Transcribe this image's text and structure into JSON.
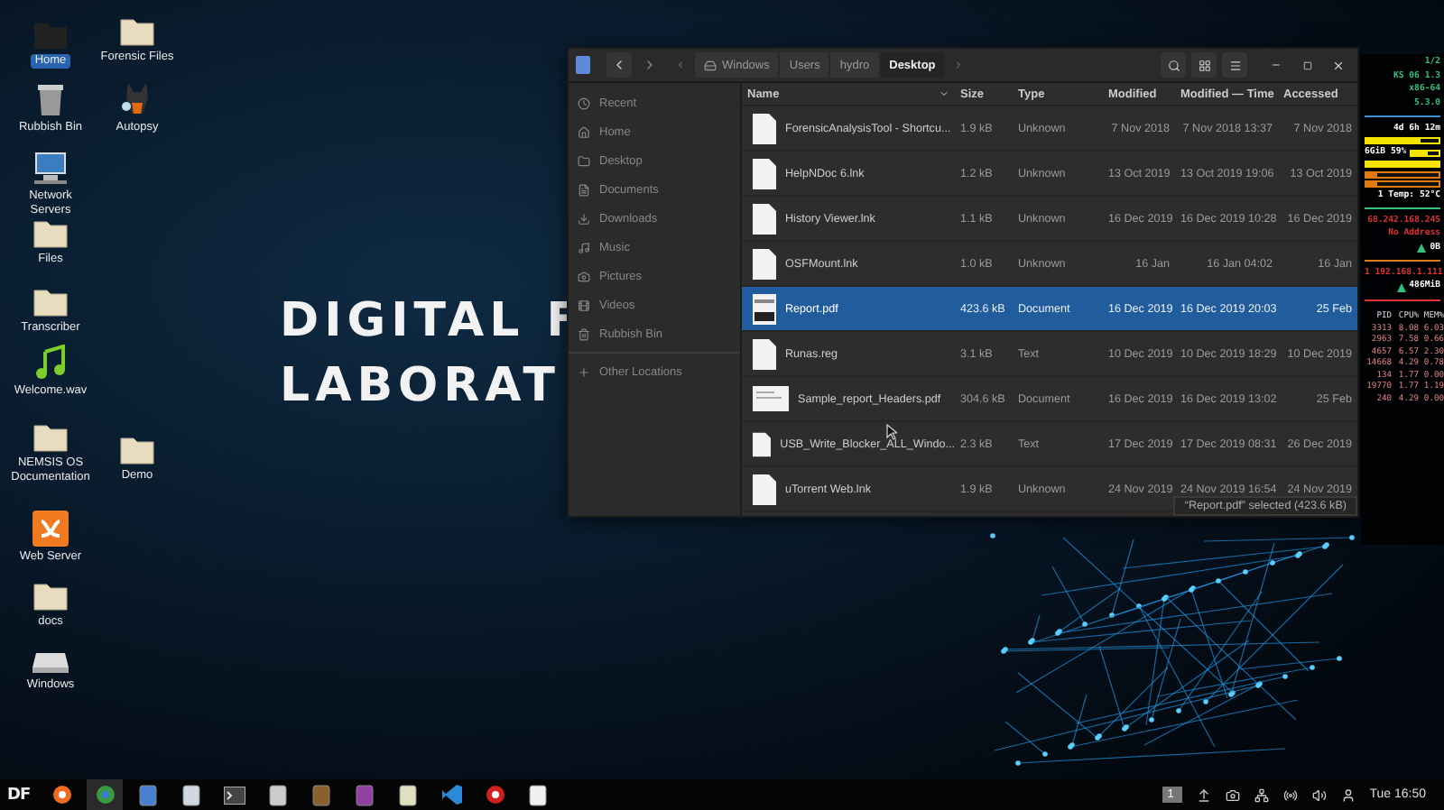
{
  "desktop": {
    "banner": [
      "DIGITAL F",
      "LABORAT"
    ],
    "icons": [
      {
        "label": "Home",
        "kind": "home",
        "selected": true
      },
      {
        "label": "Rubbish Bin",
        "kind": "trash",
        "selected": false
      },
      {
        "label": "Network Servers",
        "kind": "network",
        "selected": false
      },
      {
        "label": "Files",
        "kind": "folder",
        "selected": false
      },
      {
        "label": "Transcriber",
        "kind": "folder",
        "selected": false
      },
      {
        "label": "Welcome.wav",
        "kind": "music",
        "selected": false
      },
      {
        "label": "NEMSIS OS Documentation",
        "kind": "folder",
        "selected": false
      },
      {
        "label": "Web Server",
        "kind": "server",
        "selected": false
      },
      {
        "label": "docs",
        "kind": "folder",
        "selected": false
      },
      {
        "label": "Windows",
        "kind": "drive",
        "selected": false
      },
      {
        "label": "Forensic Files",
        "kind": "folder",
        "selected": false
      },
      {
        "label": "Autopsy",
        "kind": "dog",
        "selected": false
      },
      {
        "label": "Demo",
        "kind": "folder",
        "selected": false
      }
    ]
  },
  "file_manager": {
    "path": [
      {
        "label": "Windows",
        "selected": false
      },
      {
        "label": "Users",
        "selected": false
      },
      {
        "label": "hydro",
        "selected": false
      },
      {
        "label": "Desktop",
        "selected": true
      }
    ],
    "sidebar": [
      {
        "label": "Recent",
        "kind": "clock"
      },
      {
        "label": "Home",
        "kind": "home"
      },
      {
        "label": "Desktop",
        "kind": "folder"
      },
      {
        "label": "Documents",
        "kind": "doc"
      },
      {
        "label": "Downloads",
        "kind": "download"
      },
      {
        "label": "Music",
        "kind": "music"
      },
      {
        "label": "Pictures",
        "kind": "camera"
      },
      {
        "label": "Videos",
        "kind": "video"
      },
      {
        "label": "Rubbish Bin",
        "kind": "trash"
      },
      {
        "label": "Other Locations",
        "kind": "plus"
      }
    ],
    "columns": [
      "Name",
      "Size",
      "Type",
      "Modified",
      "Modified — Time",
      "Accessed"
    ],
    "rows": [
      {
        "name": "ForensicAnalysisTool - Shortcu...",
        "size": "1.9 kB",
        "type": "Unknown",
        "modified": "7 Nov 2018",
        "modified_time": "7 Nov 2018 13:37",
        "accessed": "7 Nov 2018",
        "kind": "doc",
        "selected": false
      },
      {
        "name": "HelpNDoc 6.lnk",
        "size": "1.2 kB",
        "type": "Unknown",
        "modified": "13 Oct 2019",
        "modified_time": "13 Oct 2019 19:06",
        "accessed": "13 Oct 2019",
        "kind": "doc",
        "selected": false
      },
      {
        "name": "History Viewer.lnk",
        "size": "1.1 kB",
        "type": "Unknown",
        "modified": "16 Dec 2019",
        "modified_time": "16 Dec 2019 10:28",
        "accessed": "16 Dec 2019",
        "kind": "doc",
        "selected": false
      },
      {
        "name": "OSFMount.lnk",
        "size": "1.0 kB",
        "type": "Unknown",
        "modified": "16 Jan",
        "modified_time": "16 Jan 04:02",
        "accessed": "16 Jan",
        "kind": "doc",
        "selected": false
      },
      {
        "name": "Report.pdf",
        "size": "423.6 kB",
        "type": "Document",
        "modified": "16 Dec 2019",
        "modified_time": "16 Dec 2019 20:03",
        "accessed": "25 Feb",
        "kind": "pdf",
        "selected": true
      },
      {
        "name": "Runas.reg",
        "size": "3.1 kB",
        "type": "Text",
        "modified": "10 Dec 2019",
        "modified_time": "10 Dec 2019 18:29",
        "accessed": "10 Dec 2019",
        "kind": "doc",
        "selected": false
      },
      {
        "name": "Sample_report_Headers.pdf",
        "size": "304.6 kB",
        "type": "Document",
        "modified": "16 Dec 2019",
        "modified_time": "16 Dec 2019 13:02",
        "accessed": "25 Feb",
        "kind": "wide",
        "selected": false
      },
      {
        "name": "USB_Write_Blocker_ALL_Windo...",
        "size": "2.3 kB",
        "type": "Text",
        "modified": "17 Dec 2019",
        "modified_time": "17 Dec 2019 08:31",
        "accessed": "26 Dec 2019",
        "kind": "doc",
        "selected": false
      },
      {
        "name": "uTorrent Web.lnk",
        "size": "1.9 kB",
        "type": "Unknown",
        "modified": "24 Nov 2019",
        "modified_time": "24 Nov 2019 16:54",
        "accessed": "24 Nov 2019",
        "kind": "doc",
        "selected": false
      }
    ],
    "status": "“Report.pdf” selected (423.6 kB)"
  },
  "system_monitor": {
    "lines": [
      {
        "kind": "text",
        "text": "1/2",
        "color": "#2ec27e"
      },
      {
        "kind": "text",
        "text": "KS 06 1.3",
        "color": "#2ec27e"
      },
      {
        "kind": "text",
        "text": "x86-64",
        "color": "#2ec27e"
      },
      {
        "kind": "text",
        "text": "5.3.0",
        "color": "#2ec27e"
      },
      {
        "kind": "rule",
        "color": "#3a8fd0"
      },
      {
        "kind": "text",
        "text": "4d 6h 12m",
        "color": "#ffffff"
      },
      {
        "kind": "bar",
        "level": 0.75,
        "color": "#f5e400"
      },
      {
        "kind": "bar",
        "text": "6GiB 59%",
        "level": 0.6,
        "color": "#f5e400"
      },
      {
        "kind": "bar",
        "level": 1,
        "color": "#f5e400"
      },
      {
        "kind": "bar",
        "level": 0.15,
        "color": "#e07a10"
      },
      {
        "kind": "bar",
        "level": 0.15,
        "color": "#e07a10"
      },
      {
        "kind": "text",
        "text": "1 Temp: 52°C",
        "color": "#ffffff"
      },
      {
        "kind": "rule",
        "color": "#2ec27e"
      },
      {
        "kind": "text",
        "text": "68.242.168.245",
        "color": "#e03030"
      },
      {
        "kind": "text",
        "text": "No Address",
        "color": "#e03030"
      },
      {
        "kind": "arrow",
        "text": "0B",
        "color": "#2ec27e"
      },
      {
        "kind": "rule",
        "color": "#e07a10"
      },
      {
        "kind": "text",
        "text": "1 192.168.1.111",
        "color": "#e03030"
      },
      {
        "kind": "arrow",
        "text": "486MiB",
        "color": "#2ec27e"
      },
      {
        "kind": "rule",
        "color": "#e03030"
      }
    ],
    "processes": {
      "columns": [
        "PID",
        "CPU%",
        "MEM%"
      ],
      "rows": [
        [
          "3313",
          "8.08",
          "6.03"
        ],
        [
          "2963",
          "7.58",
          "0.66"
        ],
        [
          "4657",
          "6.57",
          "2.30"
        ],
        [
          "14668",
          "4.29",
          "0.78"
        ],
        [
          "134",
          "1.77",
          "0.00"
        ],
        [
          "19770",
          "1.77",
          "1.19"
        ],
        [
          "240",
          "4.29",
          "0.00"
        ]
      ]
    }
  },
  "taskbar": {
    "logo": "DF",
    "apps": [
      {
        "kind": "firefox",
        "selected": false
      },
      {
        "kind": "chrome",
        "selected": true
      },
      {
        "kind": "files",
        "selected": false
      },
      {
        "kind": "package",
        "selected": false
      },
      {
        "kind": "terminal",
        "selected": false
      },
      {
        "kind": "drive",
        "selected": false
      },
      {
        "kind": "archive",
        "selected": false
      },
      {
        "kind": "cube",
        "selected": false
      },
      {
        "kind": "badge",
        "selected": false
      },
      {
        "kind": "vscode",
        "selected": false
      },
      {
        "kind": "red",
        "selected": false
      },
      {
        "kind": "notes",
        "selected": false
      }
    ],
    "workspace": "1",
    "clock": "Tue 16:50"
  }
}
